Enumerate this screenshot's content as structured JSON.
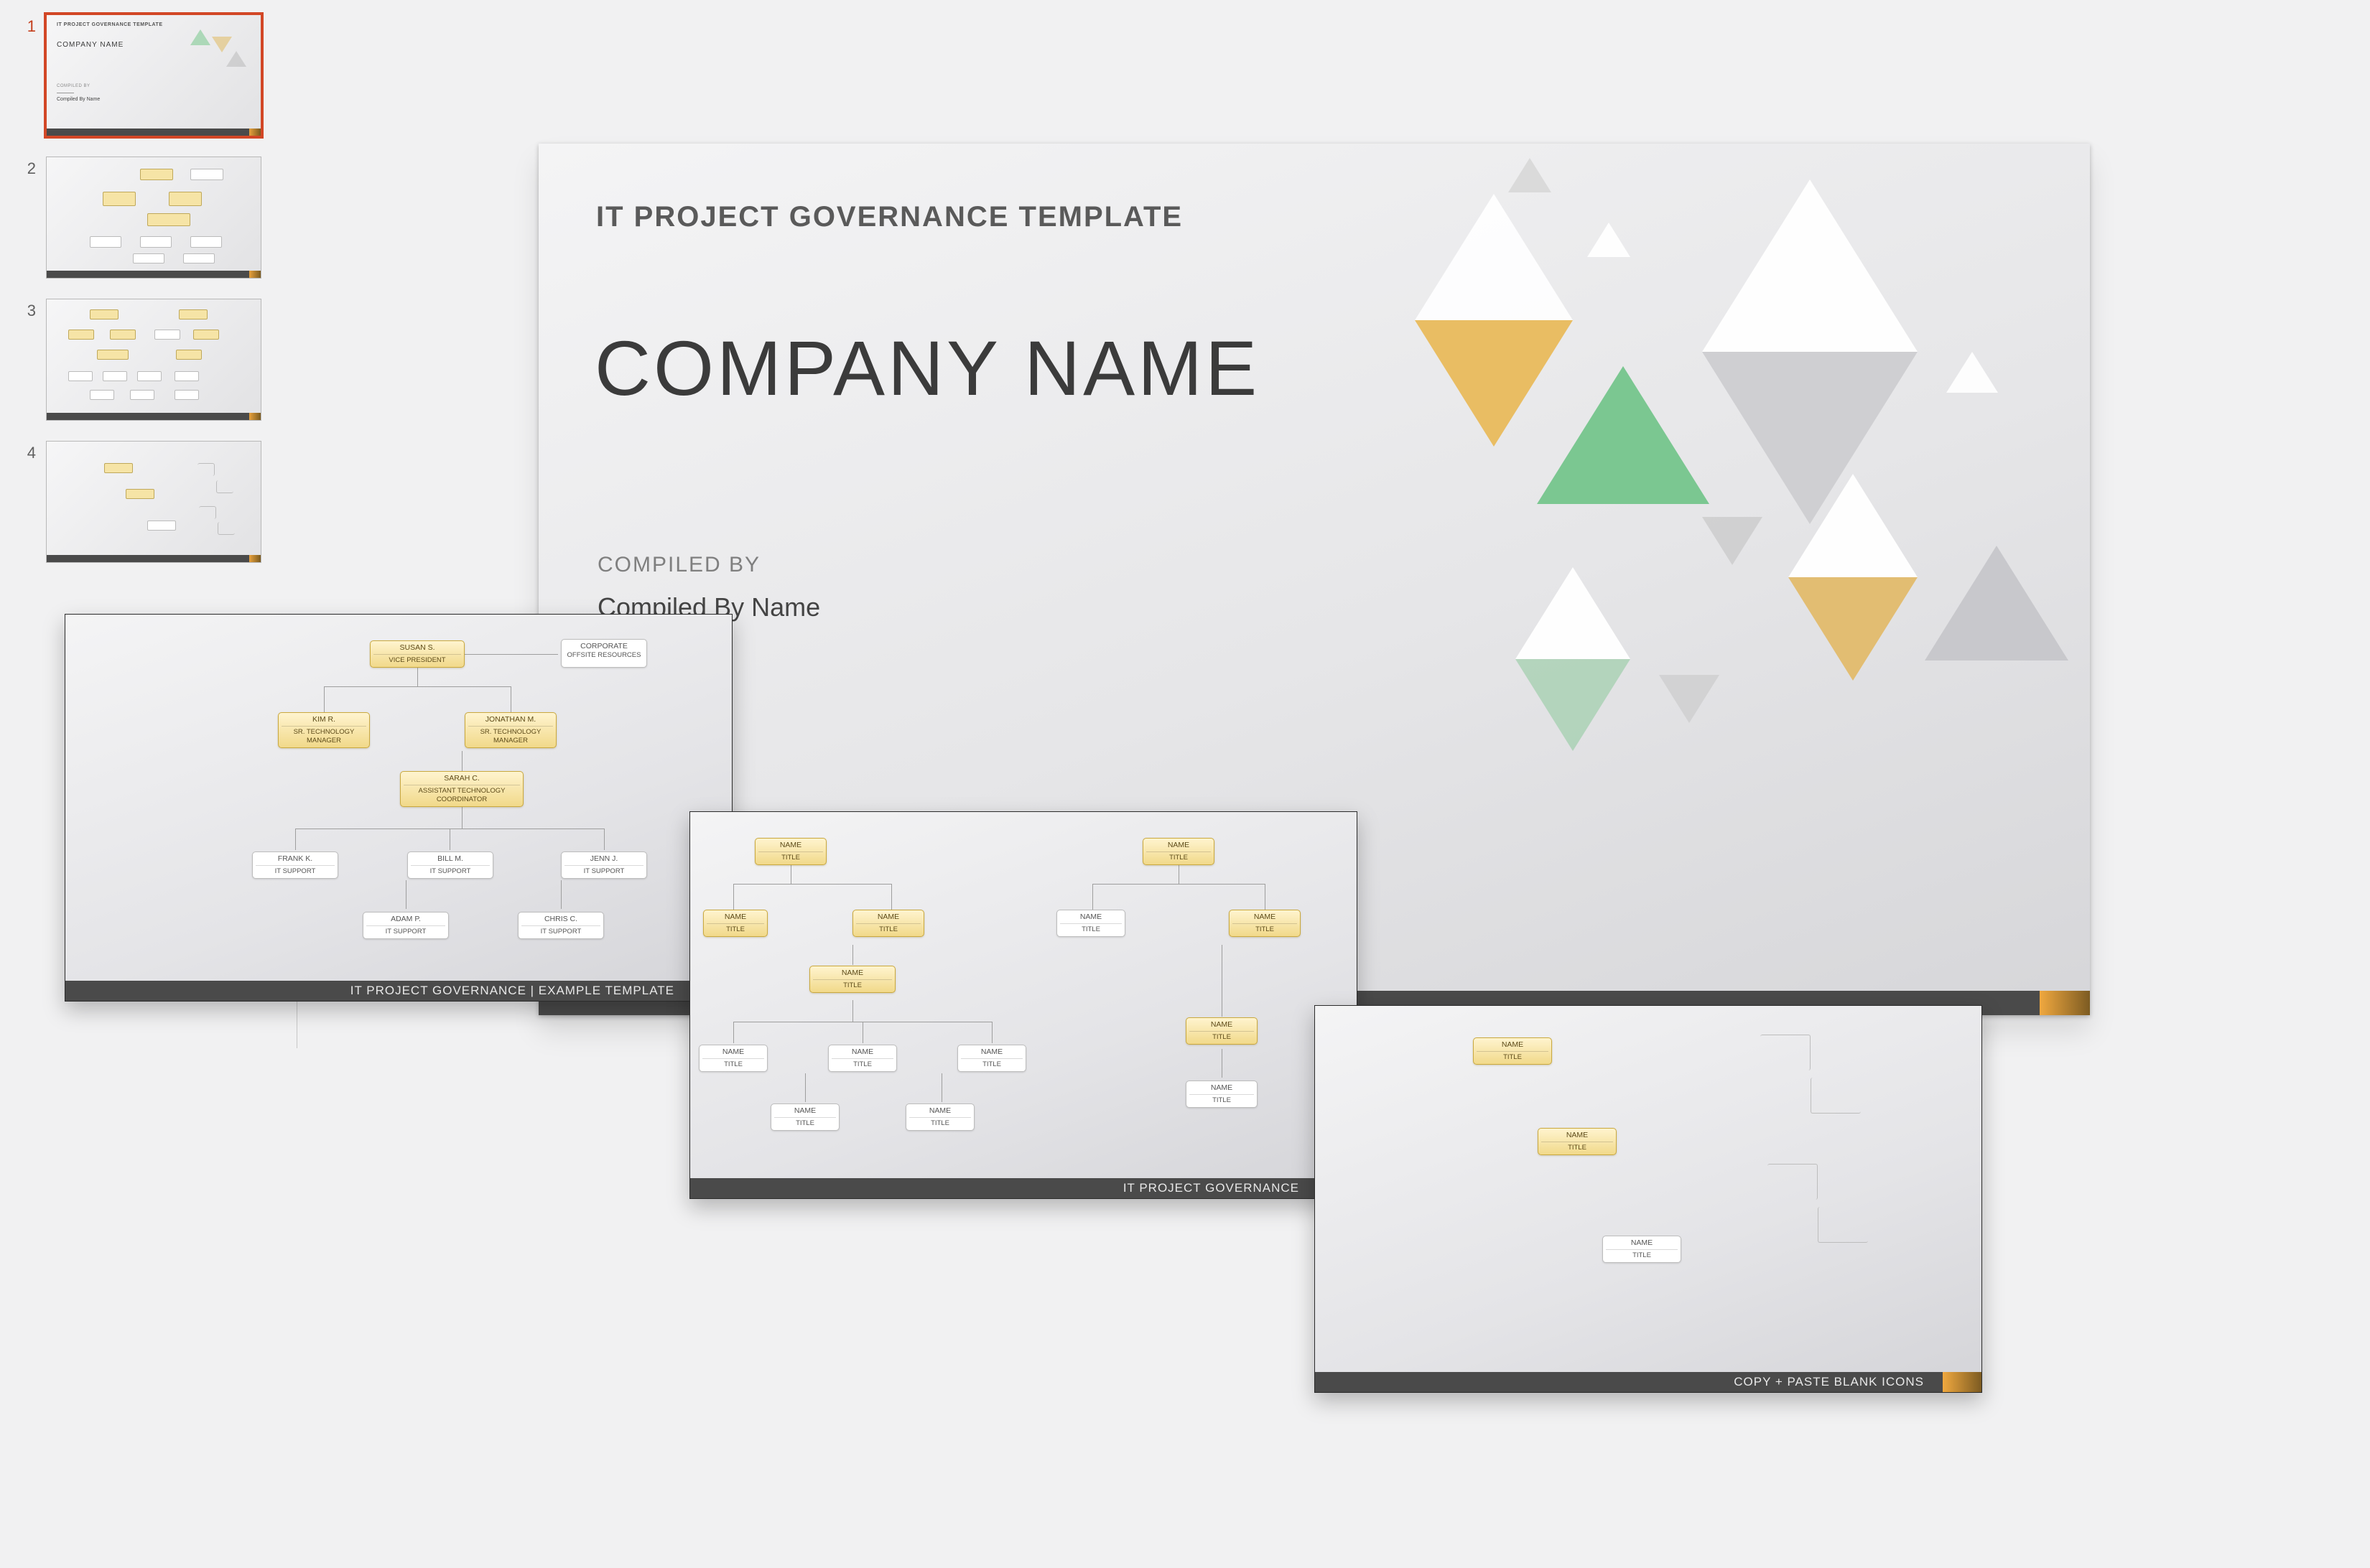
{
  "main": {
    "subtitle": "IT PROJECT GOVERNANCE TEMPLATE",
    "company": "COMPANY NAME",
    "compiled_label": "COMPILED BY",
    "compiled_name": "Compiled By Name"
  },
  "thumbs": {
    "count": 4,
    "selected": 1,
    "t1": {
      "title": "IT PROJECT GOVERNANCE TEMPLATE",
      "company": "COMPANY NAME",
      "compiled": "COMPILED BY",
      "name": "Compiled By Name"
    }
  },
  "card1": {
    "footer": "IT PROJECT GOVERNANCE   |   EXAMPLE TEMPLATE",
    "nodes": {
      "vp": {
        "n1": "SUSAN S.",
        "n2": "VICE PRESIDENT"
      },
      "corp": {
        "n1": "CORPORATE",
        "n2": "OFFSITE RESOURCES"
      },
      "kim": {
        "n1": "KIM R.",
        "n2": "SR. TECHNOLOGY MANAGER"
      },
      "jon": {
        "n1": "JONATHAN M.",
        "n2": "SR. TECHNOLOGY MANAGER"
      },
      "sarah": {
        "n1": "SARAH C.",
        "n2": "ASSISTANT TECHNOLOGY COORDINATOR"
      },
      "frank": {
        "n1": "FRANK K.",
        "n2": "IT SUPPORT"
      },
      "bill": {
        "n1": "BILL M.",
        "n2": "IT SUPPORT"
      },
      "jenn": {
        "n1": "JENN J.",
        "n2": "IT SUPPORT"
      },
      "adam": {
        "n1": "ADAM P.",
        "n2": "IT SUPPORT"
      },
      "chris": {
        "n1": "CHRIS C.",
        "n2": "IT SUPPORT"
      }
    }
  },
  "card2": {
    "footer": "IT PROJECT GOVERNANCE",
    "generic": {
      "n1": "NAME",
      "n2": "TITLE"
    }
  },
  "card3": {
    "footer": "COPY + PASTE BLANK ICONS",
    "generic": {
      "n1": "NAME",
      "n2": "TITLE"
    }
  }
}
